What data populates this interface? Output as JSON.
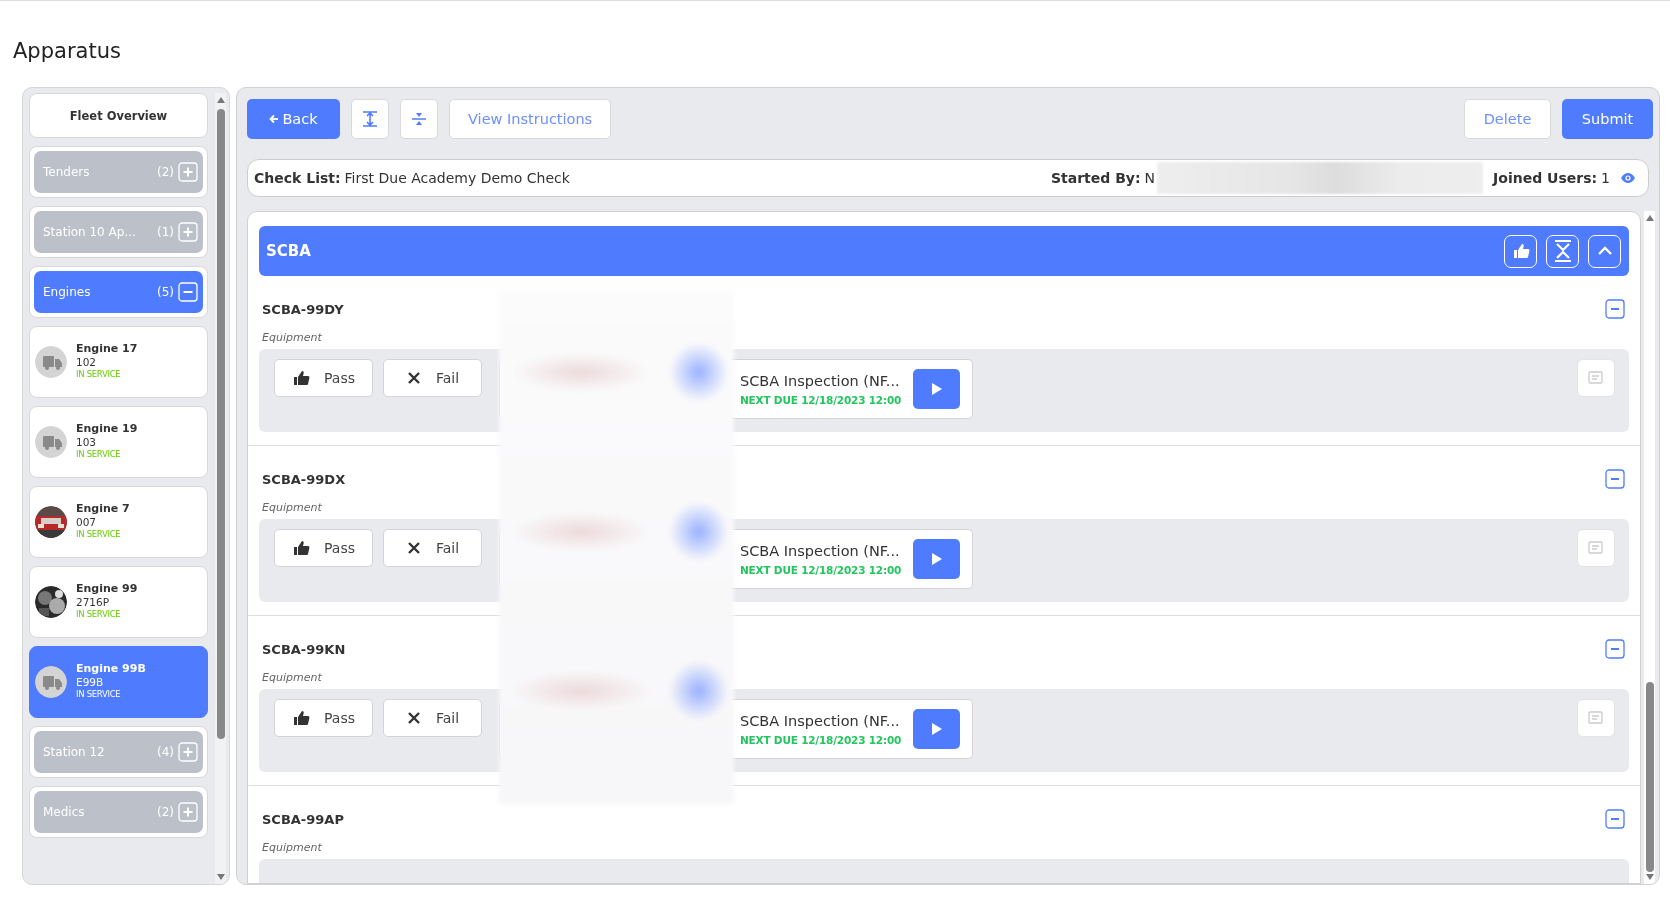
{
  "page_title": "Apparatus",
  "sidebar": {
    "items": [
      {
        "kind": "overview",
        "label": "Fleet Overview"
      },
      {
        "kind": "group",
        "label": "Tenders",
        "count": "(2)",
        "expanded": false
      },
      {
        "kind": "group",
        "label": "Station 10 Ap...",
        "count": "(1)",
        "expanded": false
      },
      {
        "kind": "group",
        "label": "Engines",
        "count": "(5)",
        "expanded": true
      },
      {
        "kind": "vehicle",
        "name": "Engine 17",
        "number": "102",
        "status": "IN SERVICE",
        "photo": false,
        "selected": false
      },
      {
        "kind": "vehicle",
        "name": "Engine 19",
        "number": "103",
        "status": "IN SERVICE",
        "photo": false,
        "selected": false
      },
      {
        "kind": "vehicle",
        "name": "Engine 7",
        "number": "007",
        "status": "IN SERVICE",
        "photo": true,
        "selected": false
      },
      {
        "kind": "vehicle",
        "name": "Engine 99",
        "number": "2716P",
        "status": "IN SERVICE",
        "photo": true,
        "selected": false
      },
      {
        "kind": "vehicle",
        "name": "Engine 99B",
        "number": "E99B",
        "status": "IN SERVICE",
        "photo": false,
        "selected": true
      },
      {
        "kind": "group",
        "label": "Station 12",
        "count": "(4)",
        "expanded": false
      },
      {
        "kind": "group",
        "label": "Medics",
        "count": "(2)",
        "expanded": false
      }
    ]
  },
  "toolbar": {
    "back": "Back",
    "view_instructions": "View Instructions",
    "delete": "Delete",
    "submit": "Submit"
  },
  "checklist": {
    "label": "Check List:",
    "value": "First Due Academy Demo Check",
    "started_by_label": "Started By:",
    "started_by_value": "N",
    "joined_label": "Joined Users:",
    "joined_value": "1"
  },
  "section": {
    "title": "SCBA",
    "items": [
      {
        "kind": "full",
        "name": "SCBA-99DY",
        "sublabel": "Equipment",
        "pass": "Pass",
        "fail": "Fail",
        "inspection": "SCBA Inspection (NF...",
        "next_due": "NEXT DUE 12/18/2023 12:00"
      },
      {
        "kind": "full",
        "name": "SCBA-99DX",
        "sublabel": "Equipment",
        "pass": "Pass",
        "fail": "Fail",
        "inspection": "SCBA Inspection (NF...",
        "next_due": "NEXT DUE 12/18/2023 12:00"
      },
      {
        "kind": "full",
        "name": "SCBA-99KN",
        "sublabel": "Equipment",
        "pass": "Pass",
        "fail": "Fail",
        "inspection": "SCBA Inspection (NF...",
        "next_due": "NEXT DUE 12/18/2023 12:00"
      },
      {
        "kind": "partial",
        "name": "SCBA-99AP",
        "sublabel": "Equipment"
      }
    ]
  }
}
